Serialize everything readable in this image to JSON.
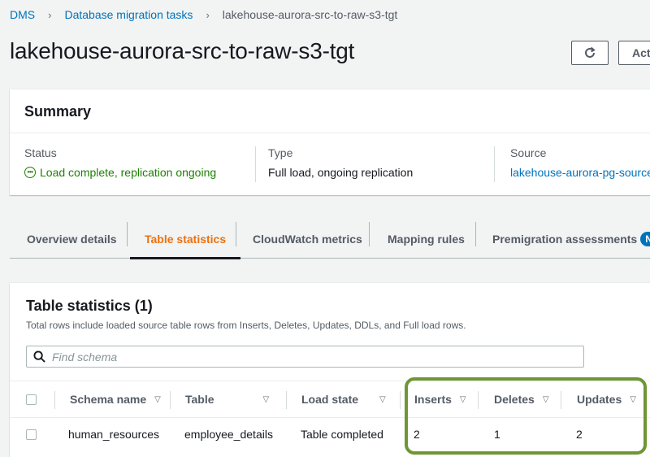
{
  "breadcrumb": {
    "items": [
      "DMS",
      "Database migration tasks"
    ],
    "current": "lakehouse-aurora-src-to-raw-s3-tgt"
  },
  "page": {
    "title": "lakehouse-aurora-src-to-raw-s3-tgt",
    "actions_label": "Act"
  },
  "summary": {
    "heading": "Summary",
    "status_label": "Status",
    "status_value": "Load complete, replication ongoing",
    "type_label": "Type",
    "type_value": "Full load, ongoing replication",
    "source_label": "Source",
    "source_value": "lakehouse-aurora-pg-source"
  },
  "tabs": [
    "Overview details",
    "Table statistics",
    "CloudWatch metrics",
    "Mapping rules",
    "Premigration assessments"
  ],
  "tabs_badge": "New",
  "table_stats": {
    "title": "Table statistics (1)",
    "description": "Total rows include loaded source table rows from Inserts, Deletes, Updates, DDLs, and Full load rows.",
    "search_placeholder": "Find schema",
    "columns": [
      "Schema name",
      "Table",
      "Load state",
      "Inserts",
      "Deletes",
      "Updates"
    ],
    "rows": [
      [
        "human_resources",
        "employee_details",
        "Table completed",
        "2",
        "1",
        "2"
      ]
    ]
  },
  "colors": {
    "link": "#0073bb",
    "status_success": "#1d8102",
    "active_tab": "#ec7211",
    "highlight": "#6e9635"
  }
}
